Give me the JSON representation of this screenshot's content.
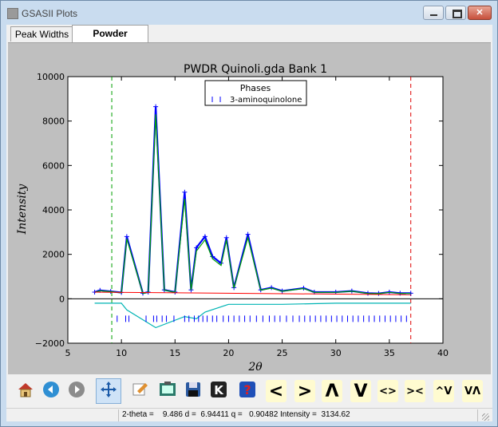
{
  "window": {
    "title": "GSASII Plots"
  },
  "tabs": [
    {
      "label": "Peak Widths",
      "active": false
    },
    {
      "label": "Powder Patterns",
      "active": true
    }
  ],
  "chart_data": {
    "type": "line",
    "title": "PWDR Quinoli.gda Bank 1",
    "xlabel": "2θ",
    "ylabel": "Intensity",
    "xlim": [
      5,
      40
    ],
    "ylim": [
      -2000,
      10000
    ],
    "xticks": [
      "5",
      "10",
      "15",
      "20",
      "25",
      "30",
      "35",
      "40"
    ],
    "yticks": [
      "−2000",
      "0",
      "2000",
      "4000",
      "6000",
      "8000",
      "10000"
    ],
    "legend": {
      "title": "Phases",
      "placement": "top-center",
      "entries": [
        "3-aminoquinolone"
      ]
    },
    "vlines": [
      {
        "x": 9.1,
        "color": "#00a000",
        "style": "dashed"
      },
      {
        "x": 37.0,
        "color": "#e00000",
        "style": "dashed"
      }
    ],
    "zero_line": 0,
    "colors": {
      "observed": "#0000ff",
      "calc": "#00a000",
      "background": "#ff0000",
      "difference": "#00b4b4",
      "ticks": "#0000ff"
    },
    "series": [
      {
        "kind": "observed",
        "x": [
          7.5,
          8,
          9,
          10,
          10.5,
          12,
          12.5,
          13.2,
          14,
          15,
          15.9,
          16.5,
          17,
          17.8,
          18.5,
          19.3,
          19.8,
          20.5,
          21.8,
          23,
          24,
          25,
          27,
          28,
          30,
          31.5,
          33,
          34,
          35,
          36,
          37
        ],
        "y": [
          300,
          380,
          330,
          280,
          2800,
          250,
          300,
          8650,
          400,
          300,
          4800,
          400,
          2300,
          2800,
          1900,
          1600,
          2750,
          500,
          2900,
          400,
          500,
          350,
          480,
          300,
          300,
          350,
          250,
          240,
          300,
          250,
          250
        ]
      },
      {
        "kind": "calc",
        "x": [
          7.5,
          8,
          9,
          10,
          10.5,
          12,
          12.5,
          13.2,
          14,
          15,
          15.9,
          16.5,
          17,
          17.8,
          18.5,
          19.3,
          19.8,
          20.5,
          21.8,
          23,
          24,
          25,
          27,
          28,
          30,
          31.5,
          33,
          34,
          35,
          36,
          37
        ],
        "y": [
          290,
          360,
          320,
          270,
          2700,
          240,
          290,
          8300,
          390,
          290,
          4500,
          390,
          2150,
          2650,
          1800,
          1500,
          2650,
          480,
          2750,
          390,
          480,
          340,
          460,
          290,
          290,
          340,
          240,
          230,
          290,
          240,
          240
        ]
      },
      {
        "kind": "background",
        "x": [
          7.5,
          37
        ],
        "y": [
          300,
          180
        ]
      },
      {
        "kind": "difference",
        "x": [
          7.5,
          10,
          10.5,
          13.2,
          15.9,
          17,
          17.8,
          20,
          25,
          30,
          37
        ],
        "y": [
          -200,
          -200,
          -500,
          -1300,
          -800,
          -900,
          -600,
          -250,
          -250,
          -200,
          -200
        ]
      }
    ],
    "reflection_ticks_y": -900,
    "reflection_ticks_x": [
      9.6,
      10.4,
      10.7,
      12.3,
      13.0,
      13.3,
      13.8,
      14.2,
      14.9,
      15.9,
      16.3,
      16.8,
      17.2,
      17.6,
      18.0,
      18.5,
      18.9,
      19.5,
      20.0,
      20.5,
      21.0,
      21.5,
      22.0,
      22.6,
      23.2,
      23.8,
      24.3,
      24.8,
      25.4,
      26.0,
      26.6,
      27.1,
      27.6,
      28.1,
      28.6,
      29.1,
      29.6,
      30.1,
      30.6,
      31.1,
      31.6,
      32.1,
      32.6,
      33.1,
      33.6,
      34.1,
      34.6,
      35.1,
      35.6,
      36.1,
      36.6
    ]
  },
  "toolbar": {
    "buttons": [
      {
        "name": "home-icon",
        "kind": "icon"
      },
      {
        "name": "back-icon",
        "kind": "icon"
      },
      {
        "name": "forward-icon",
        "kind": "icon"
      },
      {
        "name": "pan-icon",
        "kind": "icon",
        "active": true
      },
      {
        "name": "zoom-icon",
        "kind": "icon"
      },
      {
        "name": "configure-subplots-icon",
        "kind": "icon"
      },
      {
        "name": "save-icon",
        "kind": "icon"
      },
      {
        "name": "k-icon",
        "kind": "icon"
      },
      {
        "name": "help-icon",
        "kind": "icon"
      },
      {
        "name": "shift-left",
        "kind": "glyph",
        "label": "<"
      },
      {
        "name": "shift-right",
        "kind": "glyph",
        "label": ">"
      },
      {
        "name": "shift-up",
        "kind": "glyph",
        "label": "Λ"
      },
      {
        "name": "shift-down",
        "kind": "glyph",
        "label": "V"
      },
      {
        "name": "expand-x",
        "kind": "glyph",
        "label": "<>"
      },
      {
        "name": "compress-x",
        "kind": "glyph",
        "label": "><"
      },
      {
        "name": "expand-y",
        "kind": "glyph",
        "label": "^V"
      },
      {
        "name": "compress-y",
        "kind": "glyph",
        "label": "VΛ"
      }
    ]
  },
  "status": {
    "text": "2-theta =    9.486 d =  6.94411 q =   0.90482 Intensity =  3134.62"
  }
}
